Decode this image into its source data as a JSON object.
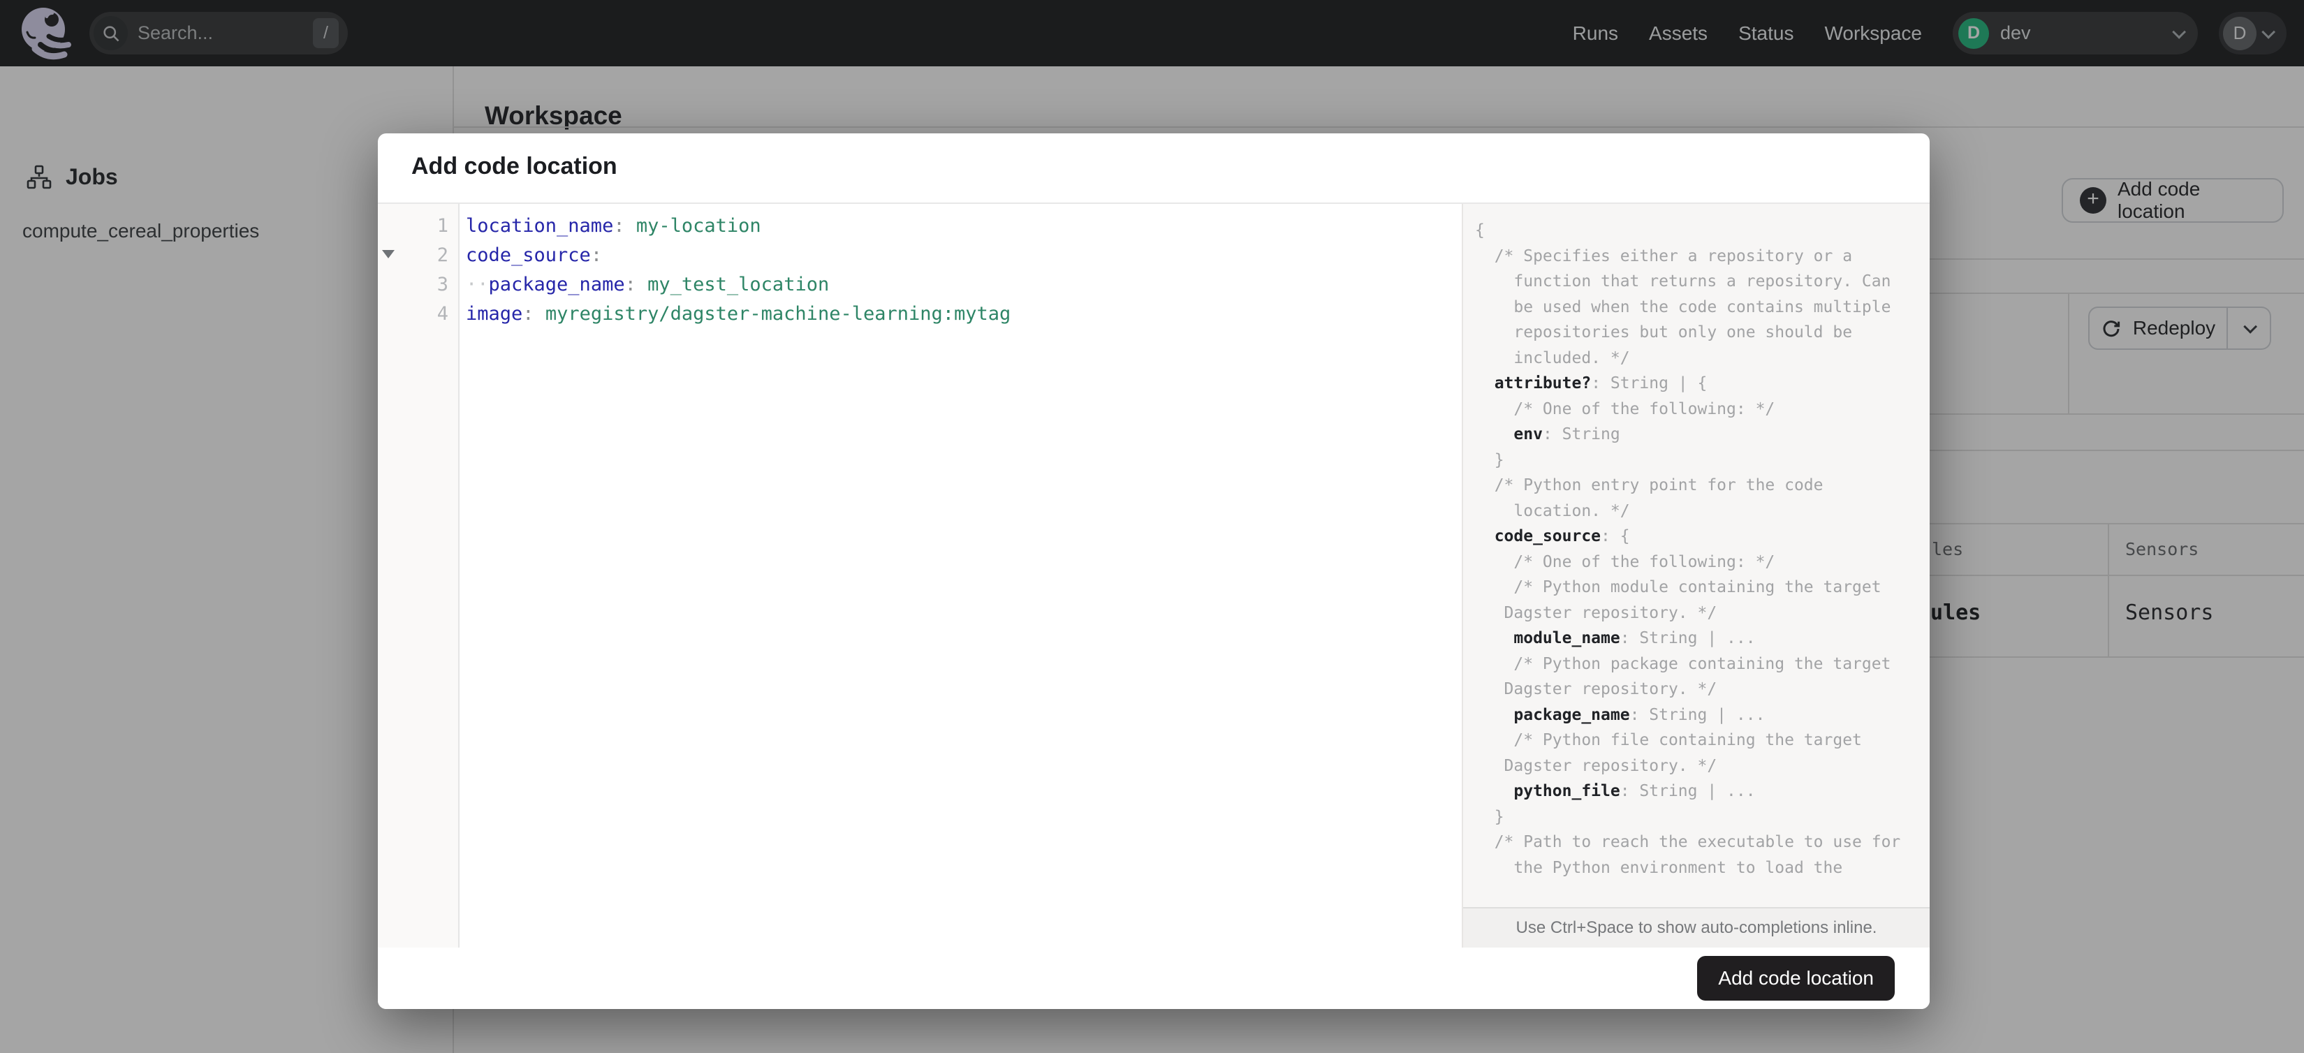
{
  "navbar": {
    "search": {
      "placeholder": "Search...",
      "shortcut": "/"
    },
    "links": [
      "Runs",
      "Assets",
      "Status",
      "Workspace"
    ],
    "deployment": {
      "initial": "D",
      "name": "dev"
    },
    "user": {
      "initial": "D"
    }
  },
  "sidebar": {
    "title": "Jobs",
    "items": [
      "compute_cereal_properties"
    ]
  },
  "page": {
    "title": "Workspace",
    "add_button_label": "Add code location",
    "redeploy_label": "Redeploy",
    "table": {
      "header": [
        "les",
        "Sensors"
      ],
      "row": [
        "ules",
        "Sensors"
      ]
    }
  },
  "modal": {
    "title": "Add code location",
    "editor": {
      "lines": [
        {
          "num": "1",
          "indent": 0,
          "key": "location_name",
          "value": "my-location",
          "fold": false
        },
        {
          "num": "2",
          "indent": 0,
          "key": "code_source",
          "value": "",
          "fold": true
        },
        {
          "num": "3",
          "indent": 2,
          "key": "package_name",
          "value": "my_test_location",
          "fold": false
        },
        {
          "num": "4",
          "indent": 0,
          "key": "image",
          "value": "myregistry/dagster-machine-learning:mytag",
          "fold": false
        }
      ]
    },
    "docs": {
      "lines": [
        {
          "t": "{"
        },
        {
          "t": "  /* Specifies either a repository or a"
        },
        {
          "t": "    function that returns a repository. Can"
        },
        {
          "t": "    be used when the code contains multiple"
        },
        {
          "t": "    repositories but only one should be"
        },
        {
          "t": "    included. */"
        },
        {
          "i": "  ",
          "k": "attribute?",
          "r": ": String | {"
        },
        {
          "t": "    /* One of the following: */"
        },
        {
          "i": "    ",
          "k": "env",
          "r": ": String"
        },
        {
          "t": "  }"
        },
        {
          "t": "  /* Python entry point for the code"
        },
        {
          "t": "    location. */"
        },
        {
          "i": "  ",
          "k": "code_source",
          "r": ": {"
        },
        {
          "t": "    /* One of the following: */"
        },
        {
          "t": "    /* Python module containing the target"
        },
        {
          "t": "   Dagster repository. */"
        },
        {
          "i": "    ",
          "k": "module_name",
          "r": ": String | ..."
        },
        {
          "t": "    /* Python package containing the target"
        },
        {
          "t": "   Dagster repository. */"
        },
        {
          "i": "    ",
          "k": "package_name",
          "r": ": String | ..."
        },
        {
          "t": "    /* Python file containing the target"
        },
        {
          "t": "   Dagster repository. */"
        },
        {
          "i": "    ",
          "k": "python_file",
          "r": ": String | ..."
        },
        {
          "t": "  }"
        },
        {
          "t": "  /* Path to reach the executable to use for"
        },
        {
          "t": "    the Python environment to load the"
        }
      ]
    },
    "hint": "Use Ctrl+Space to show auto-completions inline.",
    "submit_label": "Add code location"
  },
  "colors": {
    "accent_green": "#17b377",
    "code_key_blue": "#2626a9",
    "code_value_green": "#2e8566",
    "submit_button_bg": "#201e20",
    "navbar_bg": "#121316"
  }
}
